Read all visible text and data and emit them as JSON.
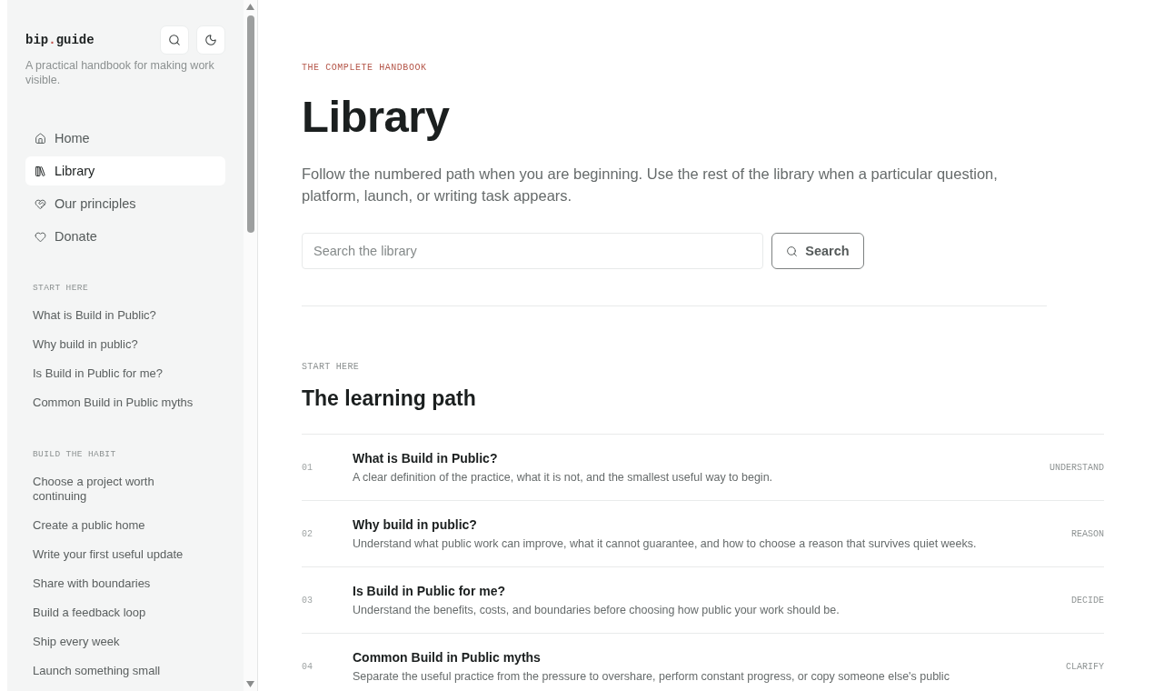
{
  "sidebar": {
    "logo": {
      "prefix": "bip",
      "separator": ".",
      "suffix": "guide"
    },
    "tagline": "A practical handbook for making work visible.",
    "nav": [
      {
        "kind": "home",
        "label": "Home",
        "selected": false
      },
      {
        "kind": "library",
        "label": "Library",
        "selected": true
      },
      {
        "kind": "principles",
        "label": "Our principles",
        "selected": false
      },
      {
        "kind": "donate",
        "label": "Donate",
        "selected": false
      }
    ],
    "sections": [
      {
        "label": "START HERE",
        "links": [
          "What is Build in Public?",
          "Why build in public?",
          "Is Build in Public for me?",
          "Common Build in Public myths"
        ]
      },
      {
        "label": "BUILD THE HABIT",
        "links": [
          "Choose a project worth continuing",
          "Create a public home",
          "Write your first useful update",
          "Share with boundaries",
          "Build a feedback loop",
          "Ship every week",
          "Launch something small"
        ]
      }
    ]
  },
  "main": {
    "eyebrow": "THE COMPLETE HANDBOOK",
    "title": "Library",
    "intro": "Follow the numbered path when you are beginning. Use the rest of the library when a particular question, platform, launch, or writing task appears.",
    "search": {
      "placeholder": "Search the library",
      "button": "Search"
    },
    "path": {
      "eyebrow": "START HERE",
      "title": "The learning path",
      "items": [
        {
          "number": "01",
          "title": "What is Build in Public?",
          "description": "A clear definition of the practice, what it is not, and the smallest useful way to begin.",
          "tag": "UNDERSTAND"
        },
        {
          "number": "02",
          "title": "Why build in public?",
          "description": "Understand what public work can improve, what it cannot guarantee, and how to choose a reason that survives quiet weeks.",
          "tag": "REASON"
        },
        {
          "number": "03",
          "title": "Is Build in Public for me?",
          "description": "Understand the benefits, costs, and boundaries before choosing how public your work should be.",
          "tag": "DECIDE"
        },
        {
          "number": "04",
          "title": "Common Build in Public myths",
          "description": "Separate the useful practice from the pressure to overshare, perform constant progress, or copy someone else's public",
          "tag": "CLARIFY"
        }
      ]
    }
  }
}
